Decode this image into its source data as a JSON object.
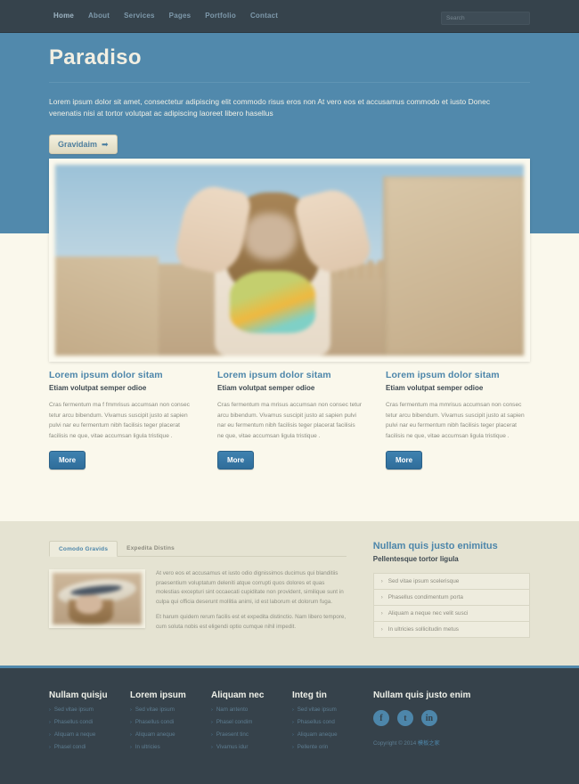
{
  "nav": {
    "items": [
      {
        "label": "Home",
        "active": true
      },
      {
        "label": "About",
        "active": false
      },
      {
        "label": "Services",
        "active": false
      },
      {
        "label": "Pages",
        "active": false
      },
      {
        "label": "Portfolio",
        "active": false
      },
      {
        "label": "Contact",
        "active": false
      }
    ],
    "search": {
      "placeholder": "Search",
      "value": ""
    }
  },
  "hero": {
    "title": "Paradiso",
    "text": "Lorem ipsum dolor sit amet, consectetur adipiscing elit commodo risus eros non At vero eos et accusamus commodo et iusto Donec venenatis nisi at tortor volutpat ac adipiscing laoreet libero hasellus",
    "button_label": "Gravidaim",
    "button_arrow": "➡"
  },
  "columns": [
    {
      "title": "Lorem ipsum dolor sitam",
      "subtitle": "Etiam volutpat semper odioe",
      "body": "Cras fermentum ma f fmmrisus accumsan non consec tetur arcu bibendum. Vivamus suscipit justo at sapien pulvi nar eu fermentum nibh facilisis teger placerat facilisis ne que, vitae accumsan ligula tristique .",
      "button_label": "More"
    },
    {
      "title": "Lorem ipsum dolor sitam",
      "subtitle": "Etiam volutpat semper odioe",
      "body": "Cras fermentum ma mrisus accumsan non consec tetur arcu bibendum. Vivamus suscipit justo at sapien pulvi nar eu fermentum nibh facilisis teger placerat facilisis ne que, vitae accumsan ligula tristique .",
      "button_label": "More"
    },
    {
      "title": "Lorem ipsum dolor sitam",
      "subtitle": "Etiam volutpat semper odioe",
      "body": "Cras fermentum ma mmrisus accumsan non consec tetur arcu bibendum. Vivamus suscipit justo at sapien pulvi nar eu fermentum nibh facilisis teger placerat facilisis ne que, vitae accumsan ligula tristique .",
      "button_label": "More"
    }
  ],
  "tabs": {
    "items": [
      {
        "label": "Comodo Gravids",
        "active": true
      },
      {
        "label": "Expedita Distins",
        "active": false
      }
    ],
    "paragraph1": "At vero eos et accusamus et iusto odio dignissimos ducimus qui blanditiis praesentium voluptatum deleniti atque corrupti quos dolores et quas molestias excepturi sint occaecati cupiditate non provident, similique sunt in culpa qui officia deserunt mollitia animi, id est laborum et dolorum fuga.",
    "paragraph2": "Et harum quidem rerum facilis est et expedita distinctio. Nam libero tempore, cum soluta nobis est eligendi optio cumque nihil impedit."
  },
  "sidebar": {
    "title": "Nullam quis justo enimitus",
    "subtitle": "Pellentesque tortor ligula",
    "items": [
      {
        "label": "Sed vitae ipsum scelerisque"
      },
      {
        "label": "Phasellus condimentum porta"
      },
      {
        "label": "Aliquam a neque nec velit susci"
      },
      {
        "label": "In ultricies sollicitudin metus"
      }
    ],
    "chevron": "›"
  },
  "footer": {
    "columns": [
      {
        "title": "Nullam quisju",
        "links": [
          "Sed vitae ipsum",
          "Phasellus condi",
          "Aliquam a neque",
          "Phasel condi"
        ]
      },
      {
        "title": "Lorem ipsum",
        "links": [
          "Sed vitae ipsum",
          "Phasellus condi",
          "Aliquam aneque",
          "In ultricies"
        ]
      },
      {
        "title": "Aliquam nec",
        "links": [
          "Nam antento",
          "Phasel condim",
          "Praesent tinc",
          "Vivamus idur"
        ]
      },
      {
        "title": "Integ tin",
        "links": [
          "Sed vitae ipsum",
          "Phasellus cond",
          "Aliquam aneque",
          "Pellente orin"
        ]
      }
    ],
    "chevron": "›",
    "social_title": "Nullam quis justo enim",
    "social": [
      {
        "name": "facebook",
        "glyph": "f"
      },
      {
        "name": "twitter",
        "glyph": "t"
      },
      {
        "name": "linkedin",
        "glyph": "in"
      }
    ],
    "copyright_prefix": "Copyright © 2014 ",
    "copyright_link": "模板之家"
  },
  "colors": {
    "accent_blue": "#5189ac",
    "dark_slate": "#36424b",
    "cream": "#faf8ec",
    "beige": "#e5e3d2",
    "link_blue": "#4d86aa"
  }
}
